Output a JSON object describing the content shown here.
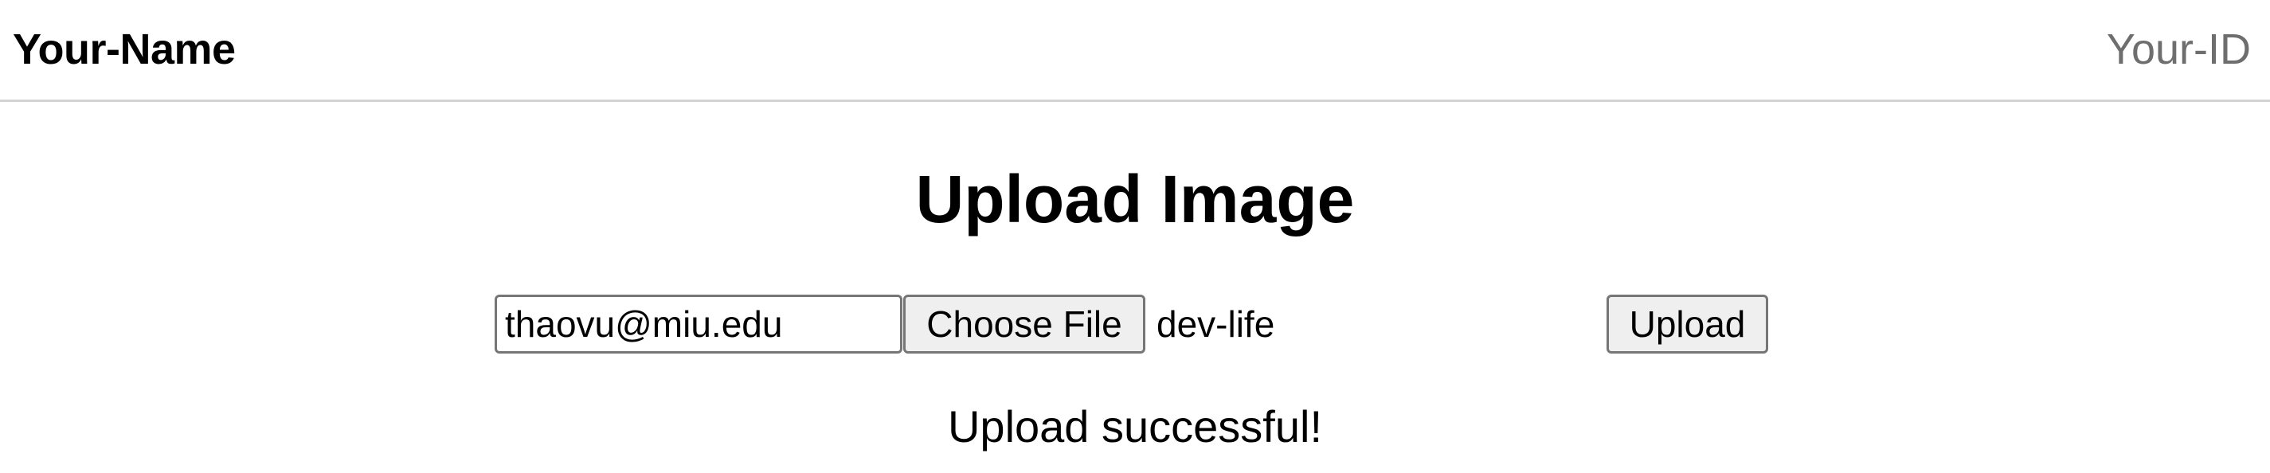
{
  "header": {
    "name": "Your-Name",
    "id": "Your-ID"
  },
  "main": {
    "title": "Upload Image",
    "form": {
      "email_value": "thaovu@miu.edu",
      "choose_file_label": "Choose File",
      "file_name": "dev-life",
      "upload_label": "Upload"
    },
    "status": "Upload successful!"
  }
}
